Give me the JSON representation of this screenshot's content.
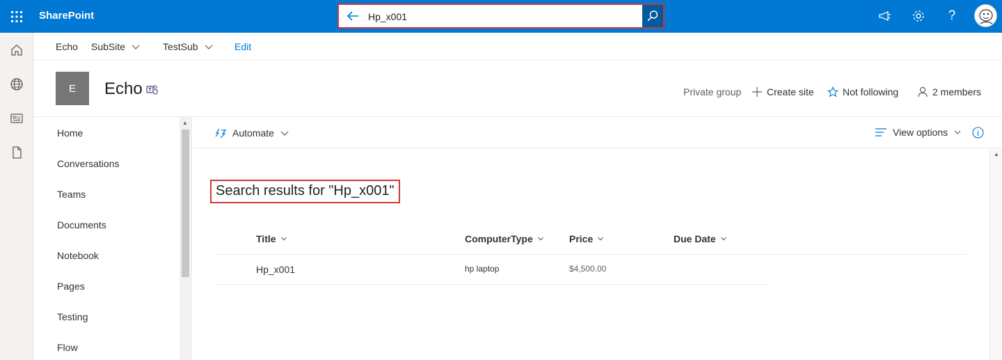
{
  "topbar": {
    "brand": "SharePoint",
    "search_value": "Hp_x001",
    "icons": [
      "app-launcher-icon",
      "back-arrow-icon",
      "search-icon",
      "megaphone-icon",
      "gear-icon",
      "help-icon",
      "avatar"
    ],
    "accent": "#0078d4"
  },
  "leftrail": {
    "icons": [
      "home-icon",
      "globe-icon",
      "news-icon",
      "file-icon"
    ]
  },
  "subnav": {
    "items": [
      {
        "label": "Echo"
      },
      {
        "label": "SubSite"
      },
      {
        "label": "TestSub"
      },
      {
        "label": "Edit"
      }
    ]
  },
  "header": {
    "logo_letter": "E",
    "title": "Echo",
    "privacy": "Private group",
    "create_site": "Create site",
    "follow": "Not following",
    "members": "2 members"
  },
  "sidenav": {
    "items": [
      "Home",
      "Conversations",
      "Teams",
      "Documents",
      "Notebook",
      "Pages",
      "Testing",
      "Flow"
    ]
  },
  "commandbar": {
    "automate": "Automate",
    "view_options": "View options"
  },
  "results": {
    "heading": "Search results for \"Hp_x001\"",
    "columns": [
      "Title",
      "ComputerType",
      "Price",
      "Due Date"
    ],
    "rows": [
      {
        "title": "Hp_x001",
        "computer_type": "hp laptop",
        "price": "$4,500.00",
        "due_date": ""
      }
    ]
  },
  "colors": {
    "highlight_border": "#d13438",
    "link": "#0078d4"
  }
}
